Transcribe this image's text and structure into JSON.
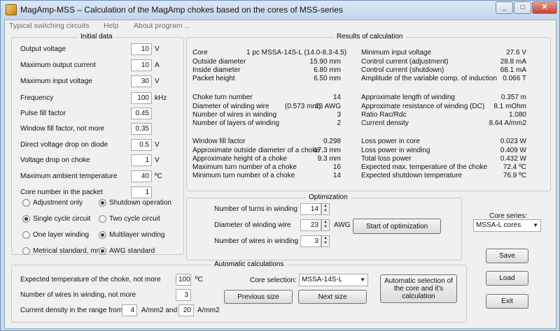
{
  "window": {
    "title": "MagAmp-MSS – Calculation of the MagAmp chokes based on the cores of MSS-series",
    "minimize": "_",
    "maximize": "□",
    "close": "✕"
  },
  "menu": [
    "Typical switching circuits",
    "Help",
    "About program ..."
  ],
  "initial": {
    "title": "Initial data",
    "rows": [
      {
        "label": "Output voltage",
        "value": "10",
        "unit": "V"
      },
      {
        "label": "Maximum output current",
        "value": "10",
        "unit": "A"
      },
      {
        "label": "Maximum input voltage",
        "value": "30",
        "unit": "V"
      },
      {
        "label": "Frequency",
        "value": "100",
        "unit": "kHz"
      },
      {
        "label": "Pulse fill factor",
        "value": "0.45",
        "unit": ""
      },
      {
        "label": "Window fill factor, not more",
        "value": "0.35",
        "unit": ""
      },
      {
        "label": "Direct voltage drop on diode",
        "value": "0.5",
        "unit": "V"
      },
      {
        "label": "Voltage drop on choke",
        "value": "1",
        "unit": "V"
      },
      {
        "label": "Maximum ambient temperature",
        "value": "40",
        "unit": "ºC"
      },
      {
        "label": "Core number in the packet",
        "value": "1",
        "unit": ""
      }
    ],
    "radios": [
      {
        "label": "Adjustment only",
        "checked": false
      },
      {
        "label": "Shutdown operation",
        "checked": true
      },
      {
        "label": "Single cycle circuit",
        "checked": true
      },
      {
        "label": "Two cycle circuit",
        "checked": false
      },
      {
        "label": "One layer winding",
        "checked": false
      },
      {
        "label": "Multilayer winding",
        "checked": true
      },
      {
        "label": "Metrical standard, mm",
        "checked": false
      },
      {
        "label": "AWG standard",
        "checked": true
      }
    ]
  },
  "results": {
    "title": "Results of calculation",
    "left": [
      {
        "label": "Core",
        "value": "1 pc MSSA-14S-L (14.0-8.3-4.5)"
      },
      {
        "label": "Outside diameter",
        "value": "15.90 mm"
      },
      {
        "label": "Inside diameter",
        "value": "6.80 mm"
      },
      {
        "label": "Packet height",
        "value": "6.50 mm"
      },
      {
        "label": "Choke turn number",
        "value": "14"
      },
      {
        "label": "Diameter of winding wire",
        "extra": "(0.573 mm)",
        "value": "23 AWG"
      },
      {
        "label": "Number of wires in winding",
        "value": "3"
      },
      {
        "label": "Number of layers of winding",
        "value": "2"
      },
      {
        "label": "Window fill factor",
        "value": "0.298"
      },
      {
        "label": "Approximate outside diameter of a choke",
        "value": "17.3 mm"
      },
      {
        "label": "Approximate height of a choke",
        "value": "9.3 mm"
      },
      {
        "label": "Maximum turn number of a choke",
        "value": "16"
      },
      {
        "label": "Minimum turn number of a choke",
        "value": "14"
      }
    ],
    "right": [
      {
        "label": "Minimum input voltage",
        "value": "27.6 V"
      },
      {
        "label": "Control current (adjustment)",
        "value": "28.8 mA"
      },
      {
        "label": "Control current (shutdown)",
        "value": "68.1 mA"
      },
      {
        "label": "Amplitude of the variable comp. of induction",
        "value": "0.066 T"
      },
      {
        "label": "Approximate length of winding",
        "value": "0.357 m"
      },
      {
        "label": "Approximate resistance of winding (DC)",
        "value": "8.1 mOhm"
      },
      {
        "label": "Ratio Rac/Rdc",
        "value": "1.080"
      },
      {
        "label": "Current density",
        "value": "8.64 A/mm2"
      },
      {
        "label": "Loss power in core",
        "value": "0.023 W"
      },
      {
        "label": "Loss power in winding",
        "value": "0.409 W"
      },
      {
        "label": "Total loss power",
        "value": "0.432 W"
      },
      {
        "label": "Expected max. temperature of the choke",
        "value": "72.4 ºC"
      },
      {
        "label": "Expected shutdown temperature",
        "value": "76.9 ºC"
      }
    ]
  },
  "optimization": {
    "title": "Optimization",
    "turns_label": "Number of turns in winding",
    "turns_value": "14",
    "diameter_label": "Diameter of winding wire",
    "diameter_value": "23",
    "diameter_unit": "AWG",
    "wires_label": "Number of wires in winding",
    "wires_value": "3",
    "start_button": "Start of optimization"
  },
  "core_series": {
    "label": "Core series:",
    "value": "MSSA-L cores"
  },
  "buttons": {
    "save": "Save",
    "load": "Load",
    "exit": "Exit"
  },
  "auto": {
    "title": "Automatic calculations",
    "temp_label": "Expected temperature of the choke, not more",
    "temp_value": "100",
    "temp_unit": "ºC",
    "wires_label": "Number of wires in winding, not more",
    "wires_value": "3",
    "density_label": "Current density in the range from",
    "density_from": "4",
    "density_mid": "A/mm2 and to",
    "density_to": "20",
    "density_unit": "A/mm2",
    "core_sel_label": "Core selection:",
    "core_sel_value": "MSSA-14S-L",
    "prev_button": "Previous size",
    "next_button": "Next size",
    "auto_button": "Automatic selection of the core and it's calculation"
  }
}
